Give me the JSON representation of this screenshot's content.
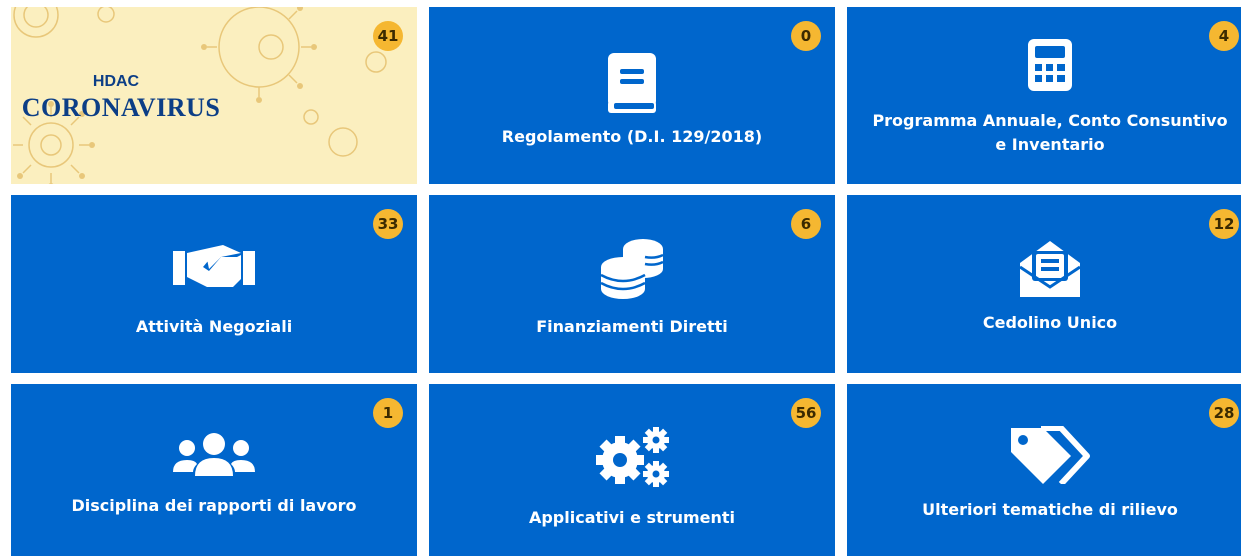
{
  "colors": {
    "tile": "#0066cc",
    "badge": "#f5b731",
    "banner_bg": "#fbefbf",
    "banner_text": "#0c3e86"
  },
  "tiles": [
    {
      "banner_top": "HDAC",
      "banner_title": "CORONAVIRUS",
      "count": "41",
      "icon": "virus-illustration"
    },
    {
      "label": "Regolamento (D.I. 129/2018)",
      "count": "0",
      "icon": "book-icon"
    },
    {
      "label": "Programma Annuale, Conto Consuntivo e Inventario",
      "count": "4",
      "icon": "calculator-icon"
    },
    {
      "label": "Attività  Negoziali",
      "count": "33",
      "icon": "handshake-icon"
    },
    {
      "label": "Finanziamenti Diretti",
      "count": "6",
      "icon": "coins-icon"
    },
    {
      "label": "Cedolino Unico",
      "count": "12",
      "icon": "envelope-open-text-icon"
    },
    {
      "label": "Disciplina dei rapporti di lavoro",
      "count": "1",
      "icon": "users-icon"
    },
    {
      "label": "Applicativi e strumenti",
      "count": "56",
      "icon": "cogs-icon"
    },
    {
      "label": "Ulteriori tematiche di rilievo",
      "count": "28",
      "icon": "tags-icon"
    }
  ]
}
